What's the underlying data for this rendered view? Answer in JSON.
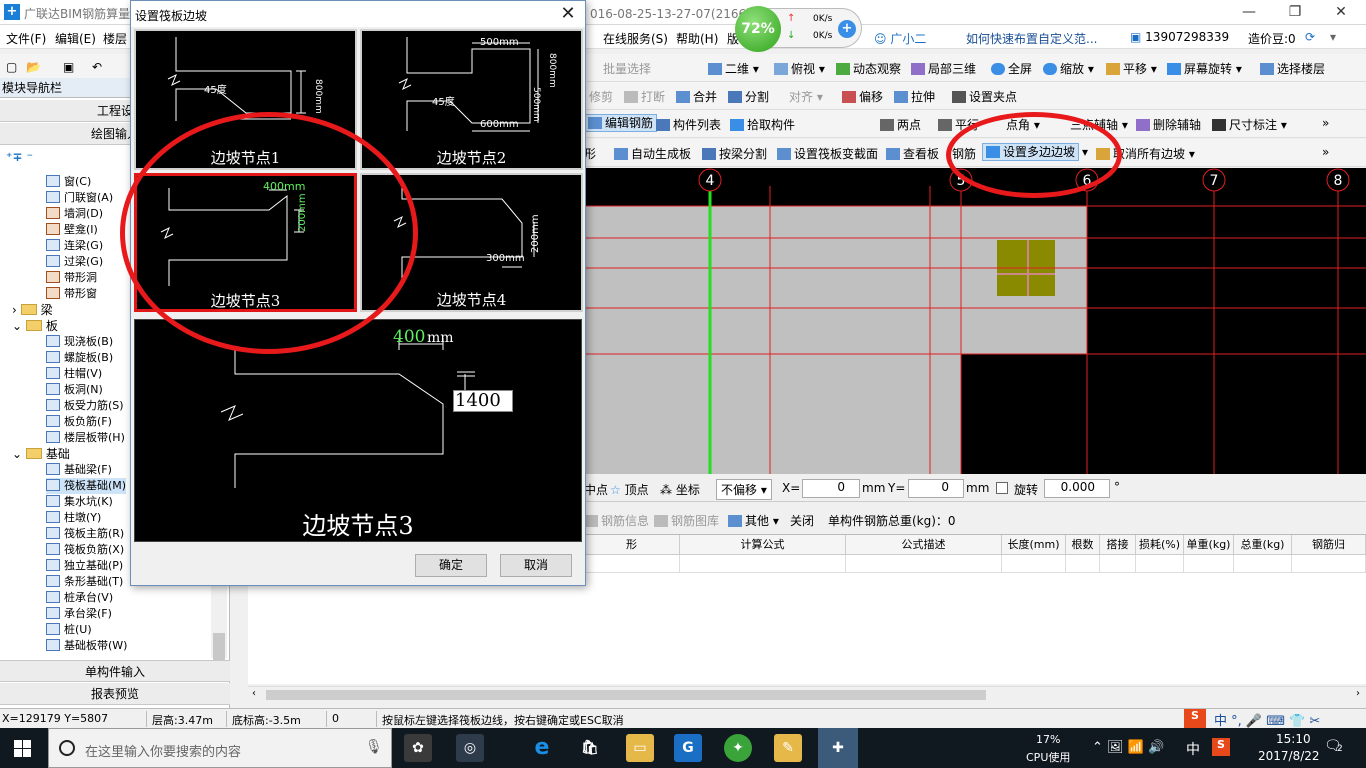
{
  "titlebar": {
    "title": "广联达BIM钢筋算量",
    "title_tail": "016-08-25-13-27-07(2166版",
    "minimize": "—",
    "restore": "❐",
    "close": "✕"
  },
  "netwidget": {
    "percent": "72%",
    "up_speed": "0K/s",
    "down_speed": "0K/s",
    "up_arrow": "↑",
    "down_arrow": "↓",
    "plus": "+"
  },
  "menubar": {
    "left": [
      "文件(F)",
      "编辑(E)",
      "楼层"
    ],
    "right": [
      "在线服务(S)",
      "帮助(H)",
      "版"
    ],
    "assistant": "广小二",
    "tip_link": "如何快速布置自定义范...",
    "phone": "13907298339",
    "price": "造价豆:0"
  },
  "toolbar1": [
    "批量选择",
    "二维",
    "俯视",
    "动态观察",
    "局部三维",
    "全屏",
    "缩放",
    "平移",
    "屏幕旋转",
    "选择楼层"
  ],
  "toolbar2": [
    "修剪",
    "打断",
    "合并",
    "分割",
    "对齐",
    "偏移",
    "拉伸",
    "设置夹点"
  ],
  "toolbar3": [
    "编辑钢筋",
    "构件列表",
    "拾取构件",
    "两点",
    "平行",
    "点角",
    "三点辅轴",
    "删除辅轴",
    "尺寸标注"
  ],
  "toolbar4": [
    "形",
    "自动生成板",
    "按梁分割",
    "设置筏板变截面",
    "查看板",
    "钢筋",
    "设置多边边坡",
    "取消所有边坡"
  ],
  "leftpanel": {
    "header": "模块导航栏",
    "btn_project": "工程设",
    "btn_draw": "绘图输入",
    "btn_single": "单构件输入",
    "btn_report": "报表预览",
    "tree_top": [
      "窗(C)",
      "门联窗(A)",
      "墙洞(D)",
      "壁龛(I)",
      "连梁(G)",
      "过梁(G)",
      "带形洞",
      "带形窗"
    ],
    "group_beam": "梁",
    "group_slab": "板",
    "tree_slab": [
      "现浇板(B)",
      "螺旋板(B)",
      "柱帽(V)",
      "板洞(N)",
      "板受力筋(S)",
      "板负筋(F)",
      "楼层板带(H)"
    ],
    "group_found": "基础",
    "tree_found": [
      "基础梁(F)",
      "筏板基础(M)",
      "集水坑(K)",
      "柱墩(Y)",
      "筏板主筋(R)",
      "筏板负筋(X)",
      "独立基础(P)",
      "条形基础(T)",
      "桩承台(V)",
      "承台梁(F)",
      "桩(U)",
      "基础板带(W)"
    ]
  },
  "canvas": {
    "axis_labels": [
      "4",
      "5",
      "6",
      "7",
      "8"
    ],
    "axis_values": [
      4,
      5,
      6,
      7,
      8
    ]
  },
  "coordbar": {
    "items": [
      "中点",
      "顶点",
      "坐标"
    ],
    "offset_mode": "不偏移",
    "x_label": "X=",
    "x_value": "0",
    "y_label": "Y=",
    "y_value": "0",
    "unit": "mm",
    "rotate_label": "旋转",
    "rotate_value": "0.000",
    "degree": "°"
  },
  "rebarbar": [
    "钢筋信息",
    "钢筋图库",
    "其他",
    "关闭",
    "单构件钢筋总重(kg)：0"
  ],
  "grid": {
    "columns": [
      "形",
      "计算公式",
      "公式描述",
      "长度(mm)",
      "根数",
      "搭接",
      "损耗(%)",
      "单重(kg)",
      "总重(kg)",
      "钢筋归"
    ]
  },
  "statusbar": {
    "coords": "X=129179 Y=5807",
    "floor_height": "层高:3.47m",
    "bottom_height": "底标高:-3.5m",
    "count": "0",
    "hint": "按鼠标左键选择筏板边线，按右键确定或ESC取消"
  },
  "taskbar": {
    "search_placeholder": "在这里输入你要搜索的内容",
    "cpu_percent": "17%",
    "cpu_label": "CPU使用",
    "ime": "中",
    "time": "15:10",
    "date": "2017/8/22",
    "notifications": "2"
  },
  "dialog": {
    "title": "设置筏板边坡",
    "close": "✕",
    "nodes": [
      {
        "label": "边坡节点1",
        "angle": "45度",
        "dim": "800mm"
      },
      {
        "label": "边坡节点2",
        "angle": "45度",
        "dim_top": "500mm",
        "dim_side1": "800mm",
        "dim_side2": "500mm",
        "dim_bottom": "600mm"
      },
      {
        "label": "边坡节点3",
        "dim_top": "400mm",
        "dim_side": "200mm"
      },
      {
        "label": "边坡节点4",
        "dim_side": "200mm",
        "dim_bottom": "300mm"
      }
    ],
    "selected_node": 3,
    "preview": {
      "label": "边坡节点3",
      "dim_top_value": "400",
      "dim_top_unit": "mm",
      "input_value": "1400"
    },
    "ok": "确定",
    "cancel": "取消"
  }
}
